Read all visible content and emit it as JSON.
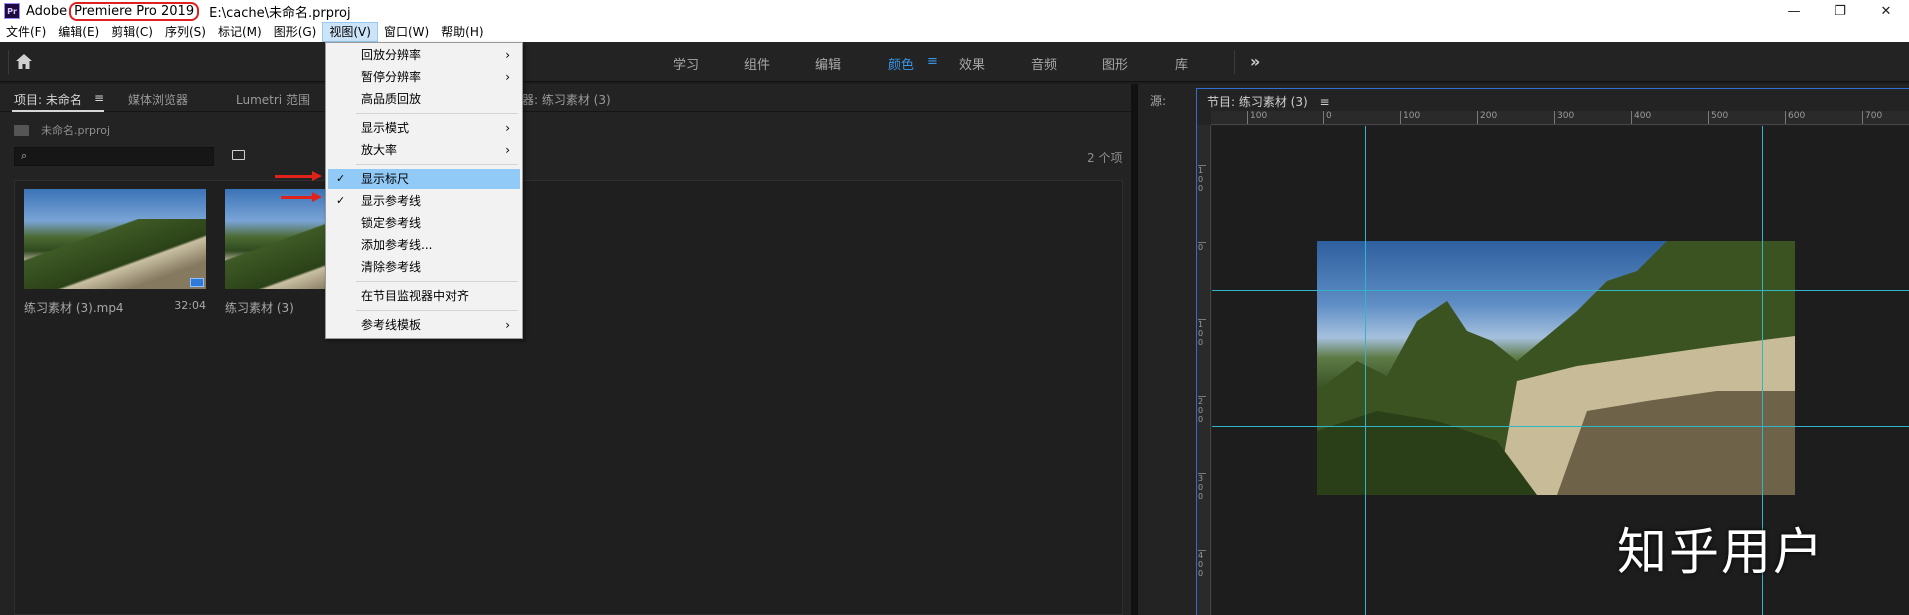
{
  "titlebar": {
    "app_prefix": "Adobe",
    "app_name": "Premiere Pro 2019",
    "path": "E:\\cache\\未命名.prproj",
    "logo": "Pr",
    "controls": {
      "minimize": "—",
      "restore": "❐",
      "close": "✕"
    }
  },
  "menubar": {
    "items": [
      "文件(F)",
      "编辑(E)",
      "剪辑(C)",
      "序列(S)",
      "标记(M)",
      "图形(G)",
      "视图(V)",
      "窗口(W)",
      "帮助(H)"
    ],
    "active_index": 6
  },
  "workspace": {
    "tabs": [
      "学习",
      "组件",
      "编辑",
      "颜色",
      "效果",
      "音频",
      "图形",
      "库"
    ],
    "active": "颜色",
    "more": "»"
  },
  "project_panel": {
    "tabs": [
      "项目: 未命名",
      "媒体浏览器",
      "Lumetri 范围",
      "器: 练习素材 (3)"
    ],
    "menu_glyph": "≡",
    "project_file": "未命名.prproj",
    "item_count": "2 个项",
    "clips": [
      {
        "name": "练习素材 (3).mp4",
        "duration": "32:04"
      },
      {
        "name": "练习素材 (3)",
        "duration": ""
      }
    ]
  },
  "program_monitor": {
    "source_tab": "源:",
    "program_tab": "节目: 练习素材 (3)",
    "menu_glyph": "≡",
    "ruler_h": [
      "100",
      "0",
      "100",
      "200",
      "300",
      "400",
      "500",
      "600",
      "700"
    ],
    "ruler_v": [
      "100",
      "0",
      "100",
      "200",
      "300",
      "400"
    ]
  },
  "view_menu": {
    "items": [
      {
        "label": "回放分辨率",
        "submenu": true,
        "checked": false
      },
      {
        "label": "暂停分辨率",
        "submenu": true,
        "checked": false
      },
      {
        "label": "高品质回放",
        "submenu": false,
        "checked": false
      },
      {
        "label": "显示模式",
        "submenu": true,
        "checked": false
      },
      {
        "label": "放大率",
        "submenu": true,
        "checked": false
      },
      {
        "label": "显示标尺",
        "submenu": false,
        "checked": true,
        "highlighted": true
      },
      {
        "label": "显示参考线",
        "submenu": false,
        "checked": true
      },
      {
        "label": "锁定参考线",
        "submenu": false,
        "checked": false
      },
      {
        "label": "添加参考线...",
        "submenu": false,
        "checked": false
      },
      {
        "label": "清除参考线",
        "submenu": false,
        "checked": false
      },
      {
        "label": "在节目监视器中对齐",
        "submenu": false,
        "checked": false
      },
      {
        "label": "参考线模板",
        "submenu": true,
        "checked": false
      }
    ],
    "check_glyph": "✓",
    "arrow_glyph": "›"
  },
  "watermark": "知乎用户",
  "colors": {
    "accent": "#3a94e8",
    "guide": "#2fb7c9",
    "annotation": "#e0221b",
    "menu_highlight": "#91c9f7"
  }
}
